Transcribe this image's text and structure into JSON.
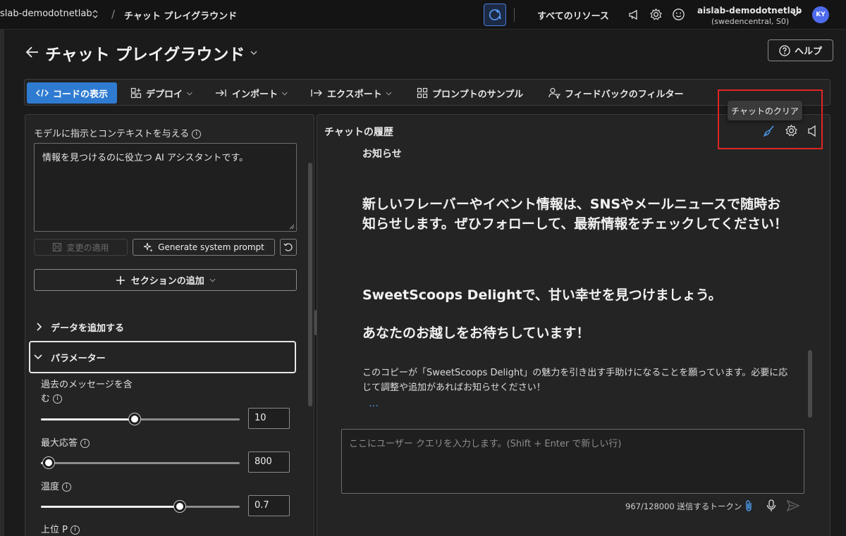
{
  "topbar": {
    "project": "slab-demodotnetlab",
    "separator": "/",
    "breadcrumb_page": "チャット プレイグラウンド",
    "all_resources": "すべてのリソース",
    "account_name": "aislab-demodotnetlab",
    "account_region": "(swedencentral, S0)",
    "avatar_initials": "KY"
  },
  "page": {
    "title": "チャット プレイグラウンド",
    "help_label": "ヘルプ"
  },
  "toolbar": {
    "view_code": "コードの表示",
    "deploy": "デプロイ",
    "import": "インポート",
    "export": "エクスポート",
    "prompt_samples": "プロンプトのサンプル",
    "feedback_filter": "フィードバックのフィルター"
  },
  "setup": {
    "system_label": "モデルに指示とコンテキストを与える",
    "system_prompt": "情報を見つけるのに役立つ AI アシスタントです。",
    "apply_changes": "変更の適用",
    "generate_prompt": "Generate system prompt",
    "add_section": "セクションの追加",
    "add_data": "データを追加する",
    "parameters": "パラメーター",
    "params": [
      {
        "label_line1": "過去のメッセージを含",
        "label_line2": "む",
        "value": "10",
        "fraction": 0.47
      },
      {
        "label_line1": "最大応答",
        "value": "800",
        "fraction": 0.04
      },
      {
        "label_line1": "温度",
        "value": "0.7",
        "fraction": 0.7
      }
    ],
    "top_p_label": "上位 P"
  },
  "chat": {
    "history_title": "チャットの履歴",
    "tooltip": "チャットのクリア",
    "heading": "お知らせ",
    "para1": "新しいフレーバーやイベント情報は、SNSやメールニュースで随時お知らせします。ぜひフォローして、最新情報をチェックしてください！",
    "para2": "SweetScoops Delightで、甘い幸せを見つけましょう。",
    "para3": "あなたのお越しをお待ちしています！",
    "note": "このコピーが「SweetScoops Delight」の魅力を引き出す手助けになることを願っています。必要に応じて調整や追加があればお知らせください！",
    "ellipsis": "…",
    "query_placeholder": "ここにユーザー クエリを入力します。(Shift + Enter で新しい行)",
    "token_count": "967/128000 送信するトークン"
  },
  "colors": {
    "accent": "#2f7bd1",
    "highlight": "#e02424",
    "background": "#1b1b1b",
    "panel": "#242424"
  }
}
